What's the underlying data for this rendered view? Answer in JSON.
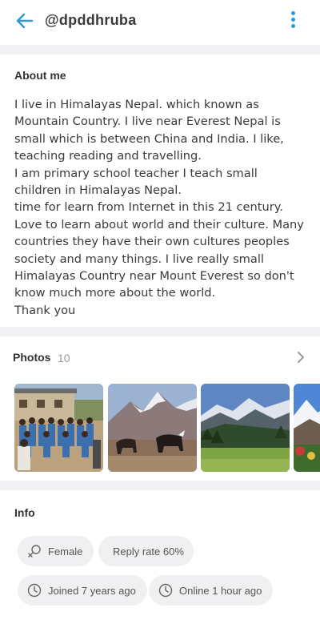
{
  "header": {
    "username": "@dpddhruba",
    "back_icon": "arrow-left-icon",
    "more_icon": "more-vertical-icon",
    "accent_color": "#2c9ad8"
  },
  "about": {
    "title": "About me",
    "text": "I live in Himalayas Nepal. which known as Mountain Country. I live near Everest Nepal is small which is between China and India. I like, teaching reading and travelling.\nI am primary school teacher I teach small children in Himalayas Nepal.\ntime for learn from Internet in this 21 century. Love to learn about world and their culture. Many countries they have their own cultures peoples society and many things. I live really small Himalayas Country near Mount Everest so don't know much more about the world.\nThank you"
  },
  "photos": {
    "title": "Photos",
    "count": "10",
    "chevron_icon": "chevron-right-icon",
    "items": [
      {
        "name": "photo-school-children"
      },
      {
        "name": "photo-yaks-mountain"
      },
      {
        "name": "photo-green-valley"
      },
      {
        "name": "photo-snow-peak"
      }
    ]
  },
  "info": {
    "title": "Info",
    "gender": "Female",
    "reply_rate": "Reply rate 60%",
    "joined": "Joined 7 years ago",
    "online": "Online 1 hour ago"
  }
}
